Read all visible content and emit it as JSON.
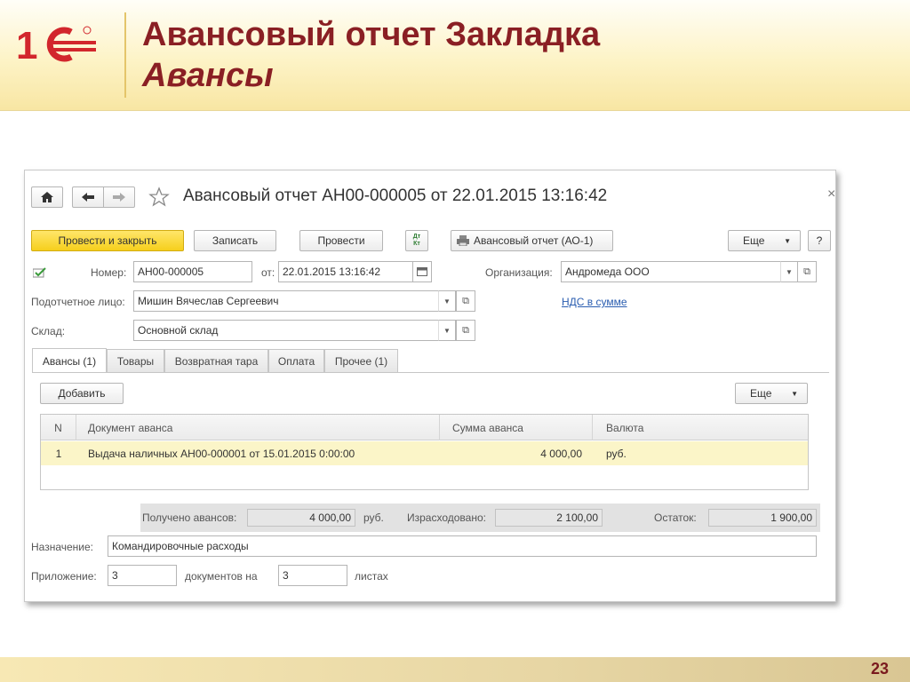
{
  "slide": {
    "logo_text": "1С",
    "title_line1": "Авансовый отчет Закладка",
    "title_line2": "Авансы",
    "page_number": "23"
  },
  "window": {
    "title": "Авансовый отчет АН00-000005 от 22.01.2015 13:16:42",
    "close_glyph": "×",
    "nav": {
      "home_icon": "home-icon",
      "back_icon": "arrow-left-icon",
      "forward_icon": "arrow-right-icon",
      "favorite_icon": "star-icon"
    },
    "toolbar": {
      "post_close": "Провести и закрыть",
      "save": "Записать",
      "post": "Провести",
      "dtkt_icon_text": "Дт Кт",
      "print_report": "Авансовый отчет (АО-1)",
      "more": "Еще",
      "help": "?"
    },
    "header": {
      "number_label": "Номер:",
      "number_value": "АН00-000005",
      "date_label": "от:",
      "date_value": "22.01.2015 13:16:42",
      "org_label": "Организация:",
      "org_value": "Андромеда ООО",
      "person_label": "Подотчетное лицо:",
      "person_value": "Мишин Вячеслав Сергеевич",
      "vat_link": "НДС в сумме",
      "warehouse_label": "Склад:",
      "warehouse_value": "Основной склад"
    },
    "tabs": [
      {
        "label": "Авансы (1)",
        "active": true
      },
      {
        "label": "Товары",
        "active": false
      },
      {
        "label": "Возвратная тара",
        "active": false
      },
      {
        "label": "Оплата",
        "active": false
      },
      {
        "label": "Прочее (1)",
        "active": false
      }
    ],
    "table_toolbar": {
      "add": "Добавить",
      "more": "Еще"
    },
    "table": {
      "columns": [
        "N",
        "Документ аванса",
        "Сумма аванса",
        "Валюта"
      ],
      "rows": [
        {
          "n": "1",
          "document": "Выдача наличных АН00-000001 от 15.01.2015 0:00:00",
          "amount": "4 000,00",
          "currency": "руб."
        }
      ]
    },
    "totals": {
      "received_label": "Получено авансов:",
      "received_value": "4 000,00",
      "received_currency": "руб.",
      "spent_label": "Израсходовано:",
      "spent_value": "2 100,00",
      "balance_label": "Остаток:",
      "balance_value": "1 900,00"
    },
    "purpose_label": "Назначение:",
    "purpose_value": "Командировочные расходы",
    "attachment_label": "Приложение:",
    "attachment_docs": "3",
    "attachment_docs_label": "документов на",
    "attachment_sheets": "3",
    "attachment_sheets_label": "листах"
  },
  "colors": {
    "title": "#8a1f24",
    "header_bg": "#fdf3c6",
    "primary_button": "#f6cf1c",
    "selected_row": "#fbf5c8",
    "link": "#2a5db0",
    "logo_red": "#d2262c"
  }
}
